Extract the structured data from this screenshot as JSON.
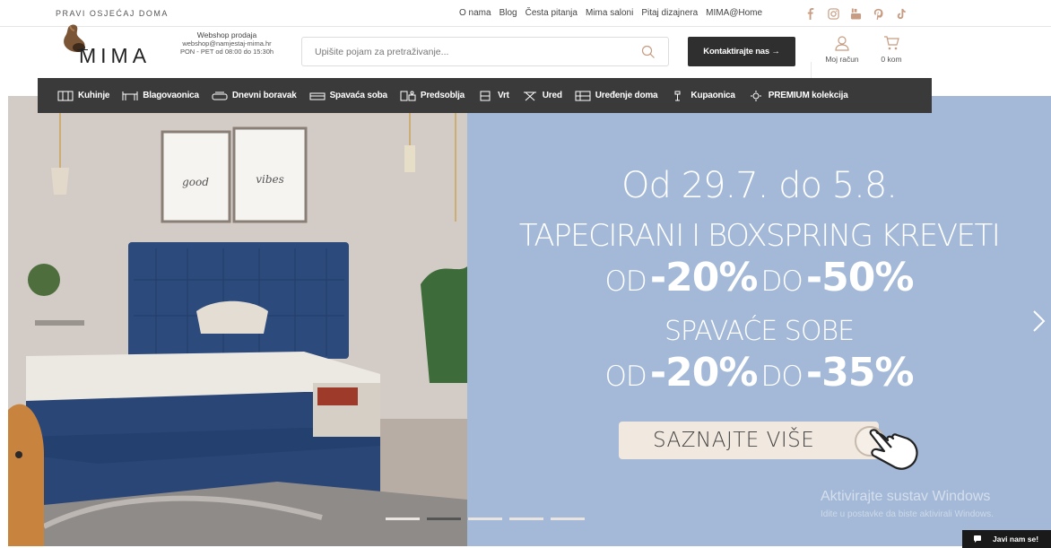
{
  "topbar": {
    "tagline": "PRAVI OSJEĆAJ DOMA",
    "links": [
      "O nama",
      "Blog",
      "Česta pitanja",
      "Mima saloni",
      "Pitaj dizajnera",
      "MIMA@Home"
    ],
    "social_icons": [
      "facebook-icon",
      "instagram-icon",
      "youtube-icon",
      "pinterest-icon",
      "tiktok-icon"
    ]
  },
  "header": {
    "logo_text": "MIMA",
    "shop_info_line1": "Webshop prodaja",
    "shop_info_line2": "webshop@namjestaj-mima.hr",
    "shop_info_line3": "PON - PET od 08:00 do 15:30h",
    "search_placeholder": "Upišite pojam za pretraživanje...",
    "contact_label": "Kontaktirajte nas →",
    "account_label": "Moj račun",
    "cart_label": "0 kom"
  },
  "nav": {
    "items": [
      {
        "label": "Kuhinje",
        "icon": "kitchen-icon"
      },
      {
        "label": "Blagovaonica",
        "icon": "dining-icon"
      },
      {
        "label": "Dnevni boravak",
        "icon": "sofa-icon"
      },
      {
        "label": "Spavaća soba",
        "icon": "bed-icon"
      },
      {
        "label": "Predsoblja",
        "icon": "hallway-icon"
      },
      {
        "label": "Vrt",
        "icon": "garden-icon"
      },
      {
        "label": "Ured",
        "icon": "office-icon"
      },
      {
        "label": "Uređenje doma",
        "icon": "decor-icon"
      },
      {
        "label": "Kupaonica",
        "icon": "bathroom-icon"
      },
      {
        "label": "PREMIUM kolekcija",
        "icon": "premium-icon"
      }
    ]
  },
  "hero": {
    "photo_text_left": "good",
    "photo_text_right": "vibes",
    "date": "Od 29.7. do 5.8.",
    "line1": "TAPECIRANI I BOXSPRING KREVETI",
    "line2_od": "OD",
    "line2_from": "-20%",
    "line2_do": "DO",
    "line2_to": "-50%",
    "line3": "SPAVAĆE SOBE",
    "line4_od": "OD",
    "line4_from": "-20%",
    "line4_do": "DO",
    "line4_to": "-35%",
    "cta": "SAZNAJTE VIŠE",
    "slide_count": 5,
    "active_slide": 2,
    "banner_color": "#a3b9d7"
  },
  "os": {
    "watermark_title": "Aktivirajte sustav Windows",
    "watermark_sub": "Idite u postavke da biste aktivirali Windows."
  },
  "chat": {
    "label": "Javi nam se!"
  }
}
